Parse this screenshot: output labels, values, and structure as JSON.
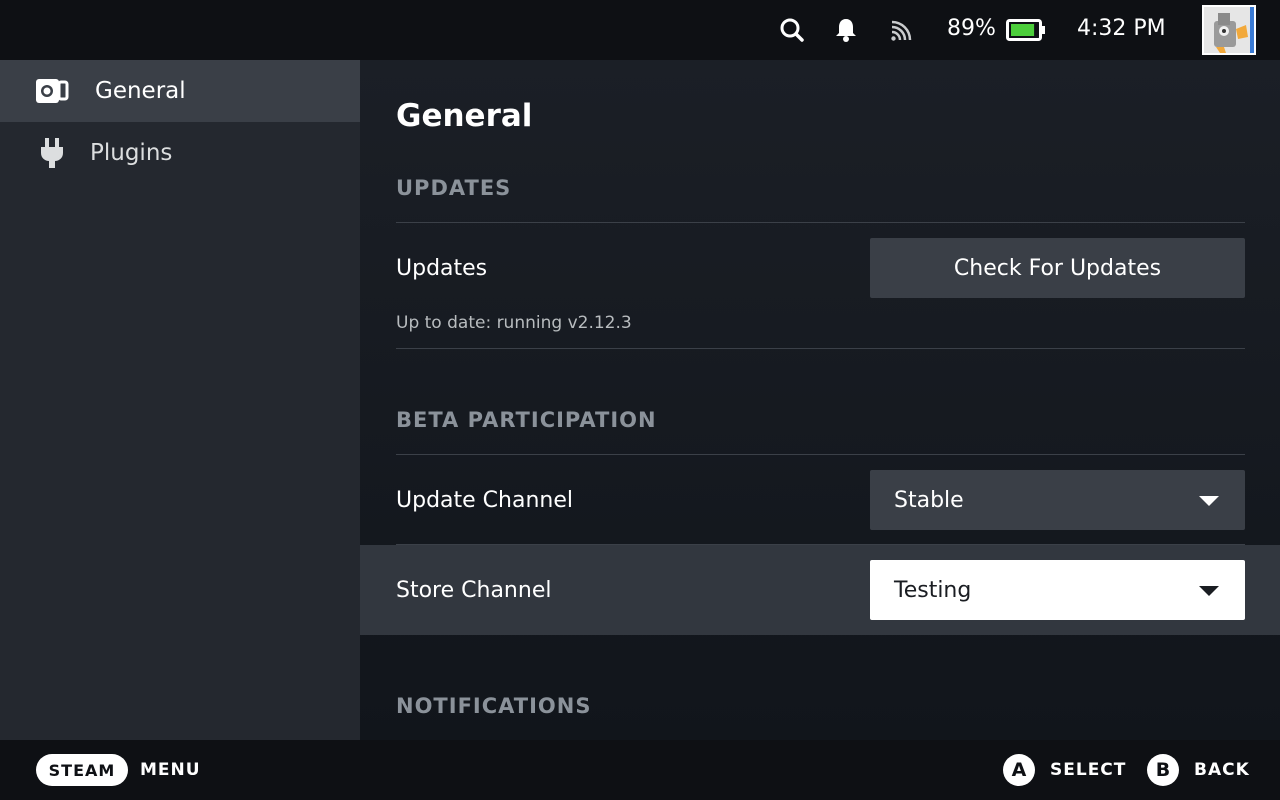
{
  "topbar": {
    "icons": [
      "search-icon",
      "bell-icon",
      "cast-icon",
      "battery-icon"
    ],
    "battery_percent": "89%",
    "battery_level": 0.89,
    "battery_color": "#4cce3b",
    "time": "4:32 PM"
  },
  "sidebar": {
    "items": [
      {
        "label": "General",
        "icon": "decky-icon",
        "active": true
      },
      {
        "label": "Plugins",
        "icon": "plug-icon",
        "active": false
      }
    ]
  },
  "main": {
    "title": "General",
    "sections": [
      {
        "title": "UPDATES",
        "rows": [
          {
            "label": "Updates",
            "control": "button",
            "button_label": "Check For Updates",
            "sublabel": "Up to date: running v2.12.3"
          }
        ]
      },
      {
        "title": "BETA PARTICIPATION",
        "rows": [
          {
            "label": "Update Channel",
            "control": "dropdown",
            "value": "Stable"
          },
          {
            "label": "Store Channel",
            "control": "dropdown",
            "value": "Testing",
            "focused": true
          }
        ]
      },
      {
        "title": "NOTIFICATIONS",
        "rows": []
      }
    ]
  },
  "bottombar": {
    "steam_label": "STEAM",
    "menu_label": "MENU",
    "a_button": "A",
    "select_label": "SELECT",
    "b_button": "B",
    "back_label": "BACK"
  }
}
